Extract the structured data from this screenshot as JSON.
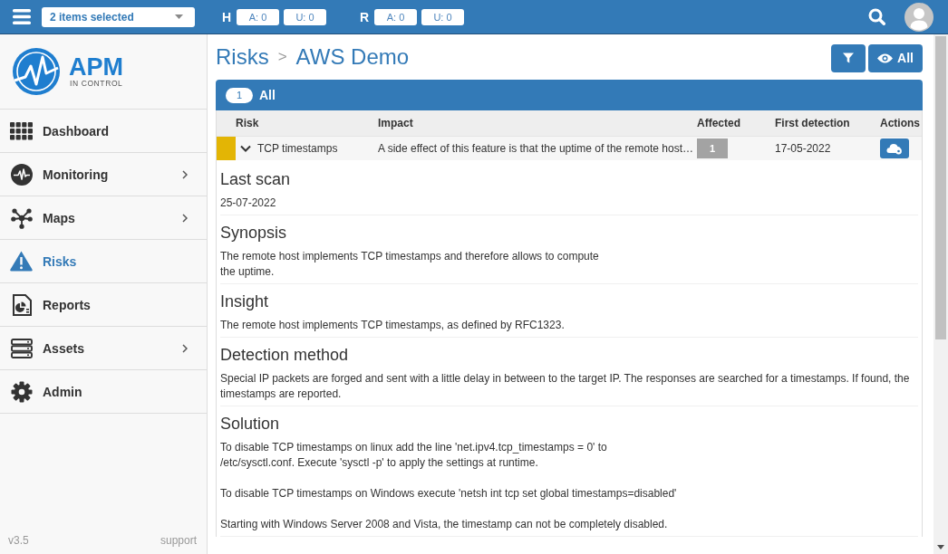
{
  "topbar": {
    "selector": {
      "value": "2 items selected"
    },
    "counters": [
      {
        "label": "H",
        "badges": [
          "A: 0",
          "U: 0"
        ]
      },
      {
        "label": "R",
        "badges": [
          "A: 0",
          "U: 0"
        ]
      }
    ]
  },
  "sidebar": {
    "logo": {
      "name": "APM",
      "tagline": "IN CONTROL"
    },
    "items": [
      {
        "label": "Dashboard",
        "selected": false,
        "submenu": false
      },
      {
        "label": "Monitoring",
        "selected": false,
        "submenu": true
      },
      {
        "label": "Maps",
        "selected": false,
        "submenu": true
      },
      {
        "label": "Risks",
        "selected": true,
        "submenu": false
      },
      {
        "label": "Reports",
        "selected": false,
        "submenu": false
      },
      {
        "label": "Assets",
        "selected": false,
        "submenu": true
      },
      {
        "label": "Admin",
        "selected": false,
        "submenu": false
      }
    ],
    "version": "v3.5",
    "support": "support"
  },
  "page": {
    "breadcrumb": [
      "Risks",
      "AWS Demo"
    ],
    "separator": ">",
    "view_button": "All"
  },
  "panel": {
    "tab": {
      "count": "1",
      "label": "All"
    },
    "table": {
      "columns": [
        "Risk",
        "Impact",
        "Affected",
        "First detection",
        "Actions"
      ],
      "rows": [
        {
          "color": "#e3b505",
          "expanded": true,
          "risk": "TCP timestamps",
          "impact": "A side effect of this feature is that the uptime of the remote host…",
          "affected": "1",
          "first_detection": "17-05-2022",
          "details": [
            {
              "heading": "Last scan",
              "text": "25-07-2022"
            },
            {
              "heading": "Synopsis",
              "text": "The remote host implements TCP timestamps and therefore allows to compute\nthe uptime."
            },
            {
              "heading": "Insight",
              "text": "The remote host implements TCP timestamps, as defined by RFC1323."
            },
            {
              "heading": "Detection method",
              "text": "Special IP packets are forged and sent with a little delay in between to the target IP. The responses are searched for a timestamps. If found, the timestamps are reported."
            },
            {
              "heading": "Solution",
              "text": "To disable TCP timestamps on linux add the line 'net.ipv4.tcp_timestamps = 0' to\n/etc/sysctl.conf. Execute 'sysctl -p' to apply the settings at runtime.\n\nTo disable TCP timestamps on Windows execute 'netsh int tcp set global timestamps=disabled'\n\nStarting with Windows Server 2008 and Vista, the timestamp can not be completely disabled."
            }
          ]
        }
      ]
    }
  }
}
